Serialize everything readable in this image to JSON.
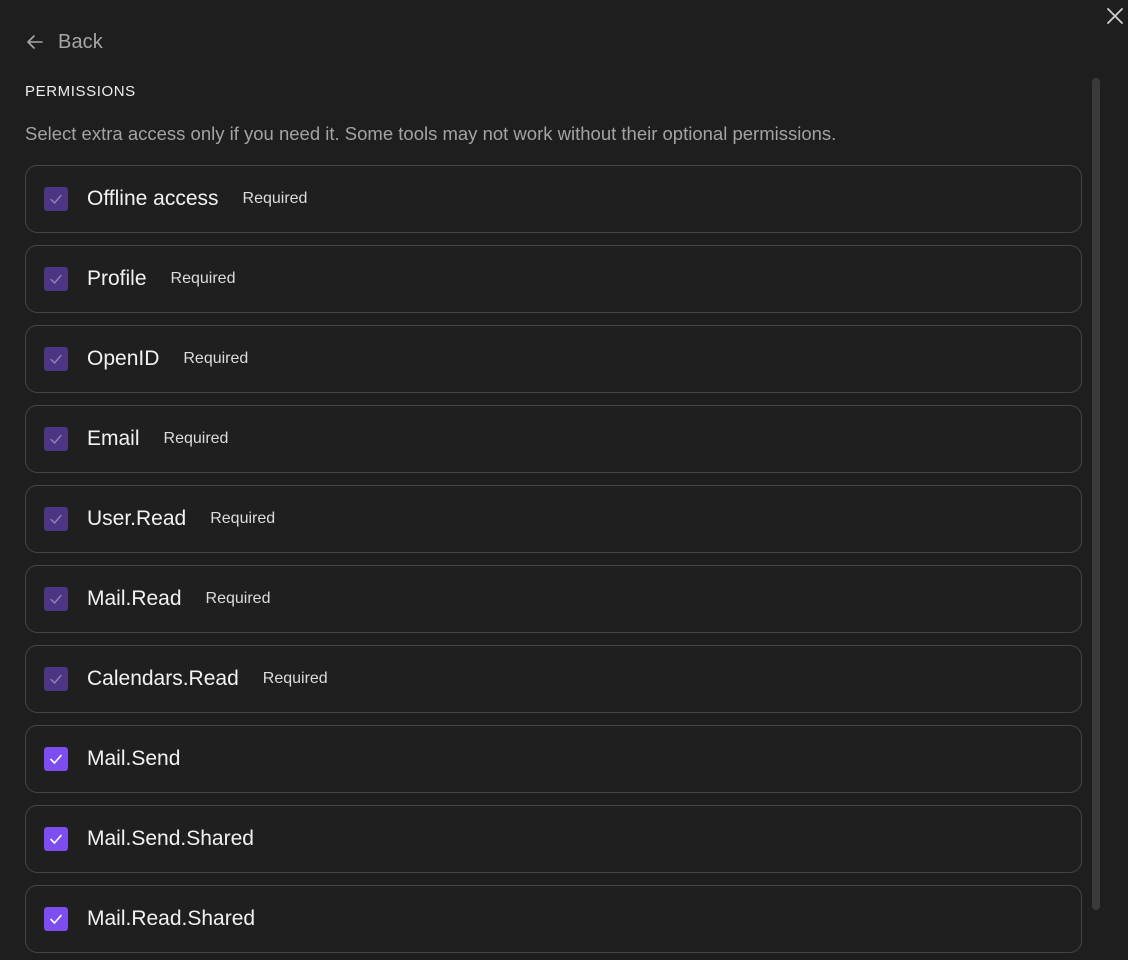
{
  "nav": {
    "back_label": "Back"
  },
  "permissions": {
    "title": "PERMISSIONS",
    "description": "Select extra access only if you need it. Some tools may not work without their optional permissions.",
    "items": [
      {
        "name": "Offline access",
        "badge": "Required",
        "checked": true,
        "locked": true
      },
      {
        "name": "Profile",
        "badge": "Required",
        "checked": true,
        "locked": true
      },
      {
        "name": "OpenID",
        "badge": "Required",
        "checked": true,
        "locked": true
      },
      {
        "name": "Email",
        "badge": "Required",
        "checked": true,
        "locked": true
      },
      {
        "name": "User.Read",
        "badge": "Required",
        "checked": true,
        "locked": true
      },
      {
        "name": "Mail.Read",
        "badge": "Required",
        "checked": true,
        "locked": true
      },
      {
        "name": "Calendars.Read",
        "badge": "Required",
        "checked": true,
        "locked": true
      },
      {
        "name": "Mail.Send",
        "badge": "",
        "checked": true,
        "locked": false
      },
      {
        "name": "Mail.Send.Shared",
        "badge": "",
        "checked": true,
        "locked": false
      },
      {
        "name": "Mail.Read.Shared",
        "badge": "",
        "checked": true,
        "locked": false
      }
    ]
  },
  "colors": {
    "background": "#1e1e1f",
    "accent": "#7c4ef0",
    "accent_disabled": "#4b3683",
    "border": "#444446"
  },
  "icons": {
    "close": "close-icon",
    "back": "arrow-left-icon",
    "check": "check-icon"
  }
}
